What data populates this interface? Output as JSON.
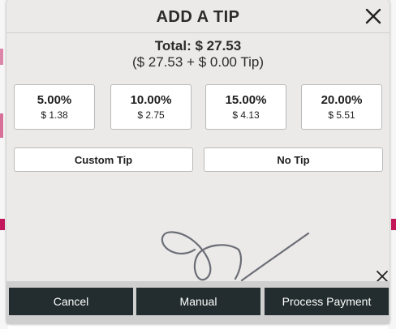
{
  "modal": {
    "title": "ADD A TIP",
    "total_line": "Total: $ 27.53",
    "breakdown_line": "($ 27.53 + $ 0.00 Tip)",
    "tip_options": [
      {
        "percent": "5.00%",
        "amount": "$ 1.38"
      },
      {
        "percent": "10.00%",
        "amount": "$ 2.75"
      },
      {
        "percent": "15.00%",
        "amount": "$ 4.13"
      },
      {
        "percent": "20.00%",
        "amount": "$ 5.51"
      }
    ],
    "custom_tip_label": "Custom Tip",
    "no_tip_label": "No Tip"
  },
  "footer": {
    "cancel_label": "Cancel",
    "manual_label": "Manual",
    "process_label": "Process Payment"
  },
  "icons": {
    "close": "close-icon",
    "clear_signature": "close-icon"
  },
  "colors": {
    "modal_bg": "#ebeae8",
    "footer_button": "#232d2f",
    "accent_background": "#c2185b",
    "signature_stroke": "#6b6d76"
  }
}
